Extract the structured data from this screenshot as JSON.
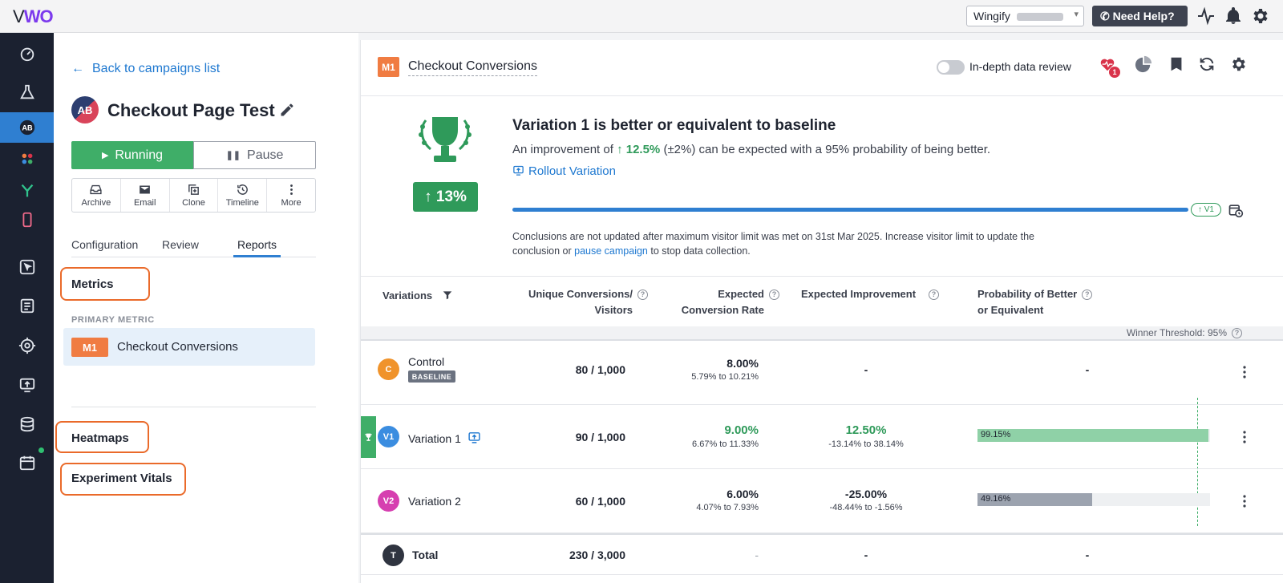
{
  "app": {
    "logo": "VWO"
  },
  "topbar": {
    "account": "Wingify",
    "help_label": "Need Help?",
    "icons": [
      "activity-icon",
      "bell-icon",
      "gear-icon"
    ]
  },
  "rail": {
    "items": [
      "dashboard-icon",
      "flask-icon",
      "ab-test-icon",
      "apps-icon",
      "funnel-icon",
      "mobile-icon",
      "cursor-icon",
      "survey-icon",
      "target-icon",
      "deploy-icon",
      "database-icon",
      "calendar-icon"
    ]
  },
  "panel": {
    "back_label": "Back to campaigns list",
    "campaign_avatar": "AB",
    "campaign_title": "Checkout Page Test",
    "running_label": "Running",
    "pause_label": "Pause",
    "actions": [
      {
        "label": "Archive",
        "icon": "archive-icon"
      },
      {
        "label": "Email",
        "icon": "mail-icon"
      },
      {
        "label": "Clone",
        "icon": "clone-icon"
      },
      {
        "label": "Timeline",
        "icon": "history-icon"
      },
      {
        "label": "More",
        "icon": "more-vertical-icon"
      }
    ],
    "tabs": [
      "Configuration",
      "Review",
      "Reports"
    ],
    "active_tab": "Reports",
    "metrics_heading": "Metrics",
    "primary_metric_label": "PRIMARY METRIC",
    "primary_metric_badge": "M1",
    "primary_metric_name": "Checkout Conversions",
    "heatmaps_heading": "Heatmaps",
    "vitals_heading": "Experiment Vitals"
  },
  "report": {
    "badge": "M1",
    "title": "Checkout Conversions",
    "toggle_label": "In-depth data review",
    "alert_count": "1",
    "summary": {
      "improvement_badge": "13%",
      "verdict": "Variation 1 is better or equivalent to baseline",
      "expect_prefix": "An improvement of",
      "expect_value": "12.5%",
      "expect_suffix": "(±2%) can be expected with a 95% probability of being better.",
      "rollout_label": "Rollout Variation",
      "progress_pill": "V1",
      "note_text": "Conclusions are not updated after maximum visitor limit was met on 31st Mar 2025. Increase visitor limit to update the conclusion or",
      "note_link": "pause campaign",
      "note_suffix": "to stop data collection."
    },
    "table": {
      "headers": {
        "variations": "Variations",
        "conversions_line1": "Unique Conversions/",
        "conversions_line2": "Visitors",
        "rate_line1": "Expected",
        "rate_line2": "Conversion Rate",
        "improvement": "Expected Improvement",
        "probability_line1": "Probability of Better",
        "probability_line2": "or Equivalent"
      },
      "winner_threshold": "Winner Threshold: 95%",
      "rows": [
        {
          "avatar": "C",
          "color": "#f0932b",
          "name": "Control",
          "tag": "BASELINE",
          "conversions": "80 / 1,000",
          "rate": "8.00%",
          "rate_range": "5.79% to 10.21%",
          "improvement": "-",
          "improvement_range": "",
          "probability": "-",
          "probability_value": null
        },
        {
          "avatar": "V1",
          "color": "#3b8de0",
          "name": "Variation 1",
          "conversions": "90 / 1,000",
          "rate": "9.00%",
          "rate_range": "6.67% to 11.33%",
          "improvement": "12.50%",
          "improvement_range": "-13.14% to 38.14%",
          "probability": "99.15%",
          "probability_value": 99.15
        },
        {
          "avatar": "V2",
          "color": "#d63fb0",
          "name": "Variation 2",
          "conversions": "60 / 1,000",
          "rate": "6.00%",
          "rate_range": "4.07% to 7.93%",
          "improvement": "-25.00%",
          "improvement_range": "-48.44% to -1.56%",
          "probability": "49.16%",
          "probability_value": 49.16
        }
      ],
      "total": {
        "avatar": "T",
        "name": "Total",
        "conversions": "230 / 3,000",
        "rate": "-",
        "improvement": "-",
        "probability": "-"
      }
    }
  },
  "colors": {
    "accent": "#2f7fd1",
    "success": "#3fae68",
    "brand_orange": "#f07c42",
    "highlight_ring": "#ea6a2a"
  }
}
